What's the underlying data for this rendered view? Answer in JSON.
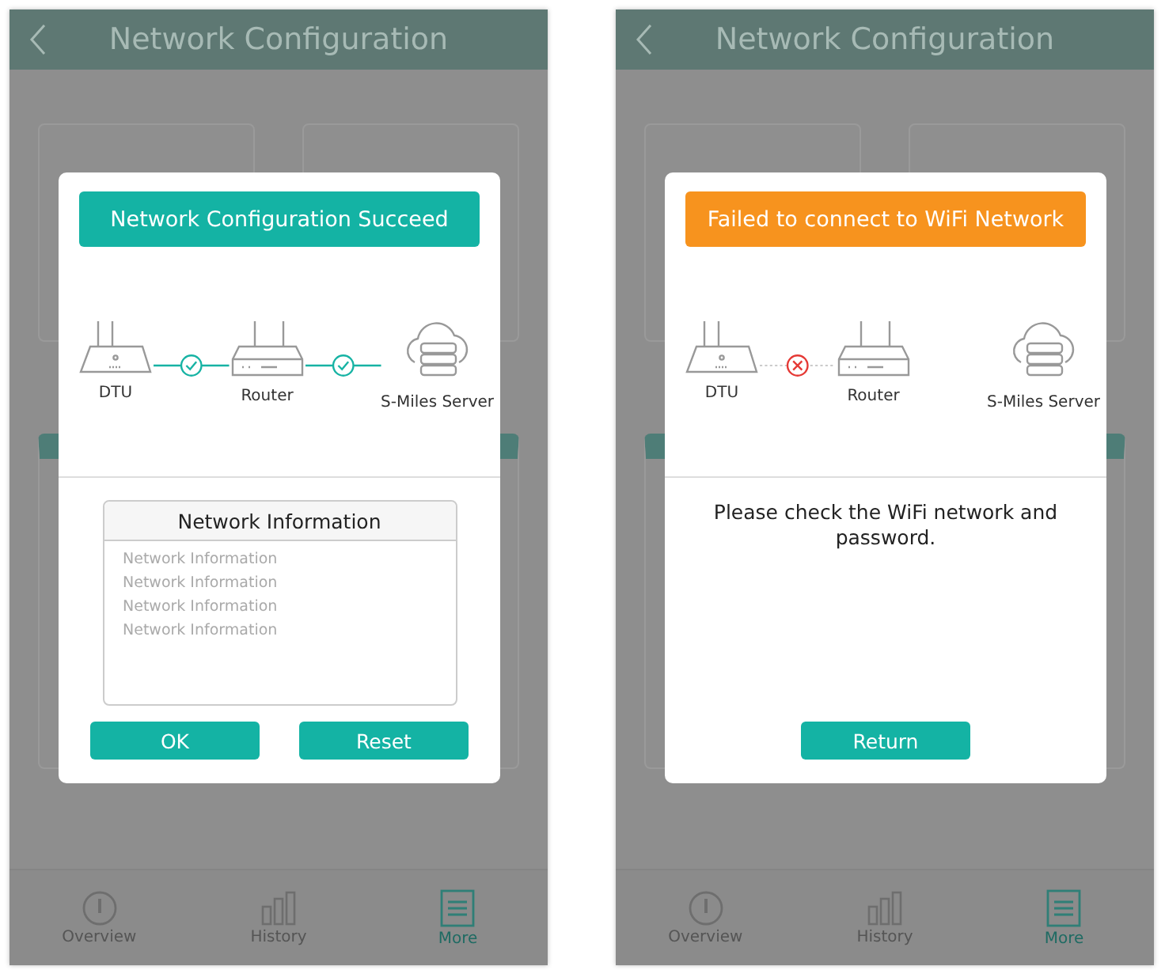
{
  "screens": [
    {
      "title": "Network Configuration",
      "dialog": {
        "kind": "success",
        "banner": "Network Configuration Succeed",
        "devices": [
          {
            "kind": "dtu",
            "label": "DTU"
          },
          {
            "kind": "router",
            "label": "Router"
          },
          {
            "kind": "server",
            "label": "S-Miles Server"
          }
        ],
        "links": [
          {
            "kind": "ok"
          },
          {
            "kind": "ok"
          }
        ],
        "info_box": {
          "heading": "Network Information",
          "lines": [
            "Network Information",
            "Network Information",
            "Network Information",
            "Network Information"
          ]
        },
        "buttons": [
          "OK",
          "Reset"
        ]
      },
      "tabs": [
        {
          "kind": "gauge",
          "label": "Overview",
          "selected": false
        },
        {
          "kind": "bars",
          "label": "History",
          "selected": false
        },
        {
          "kind": "list",
          "label": "More",
          "selected": true
        }
      ]
    },
    {
      "title": "Network Configuration",
      "dialog": {
        "kind": "failure",
        "banner": "Failed to connect to WiFi Network",
        "devices": [
          {
            "kind": "dtu",
            "label": "DTU"
          },
          {
            "kind": "router",
            "label": "Router"
          },
          {
            "kind": "server",
            "label": "S-Miles Server"
          }
        ],
        "links": [
          {
            "kind": "fail"
          }
        ],
        "message": "Please check the WiFi network and password.",
        "buttons": [
          "Return"
        ]
      },
      "tabs": [
        {
          "kind": "gauge",
          "label": "Overview",
          "selected": false
        },
        {
          "kind": "bars",
          "label": "History",
          "selected": false
        },
        {
          "kind": "list",
          "label": "More",
          "selected": true
        }
      ]
    }
  ]
}
